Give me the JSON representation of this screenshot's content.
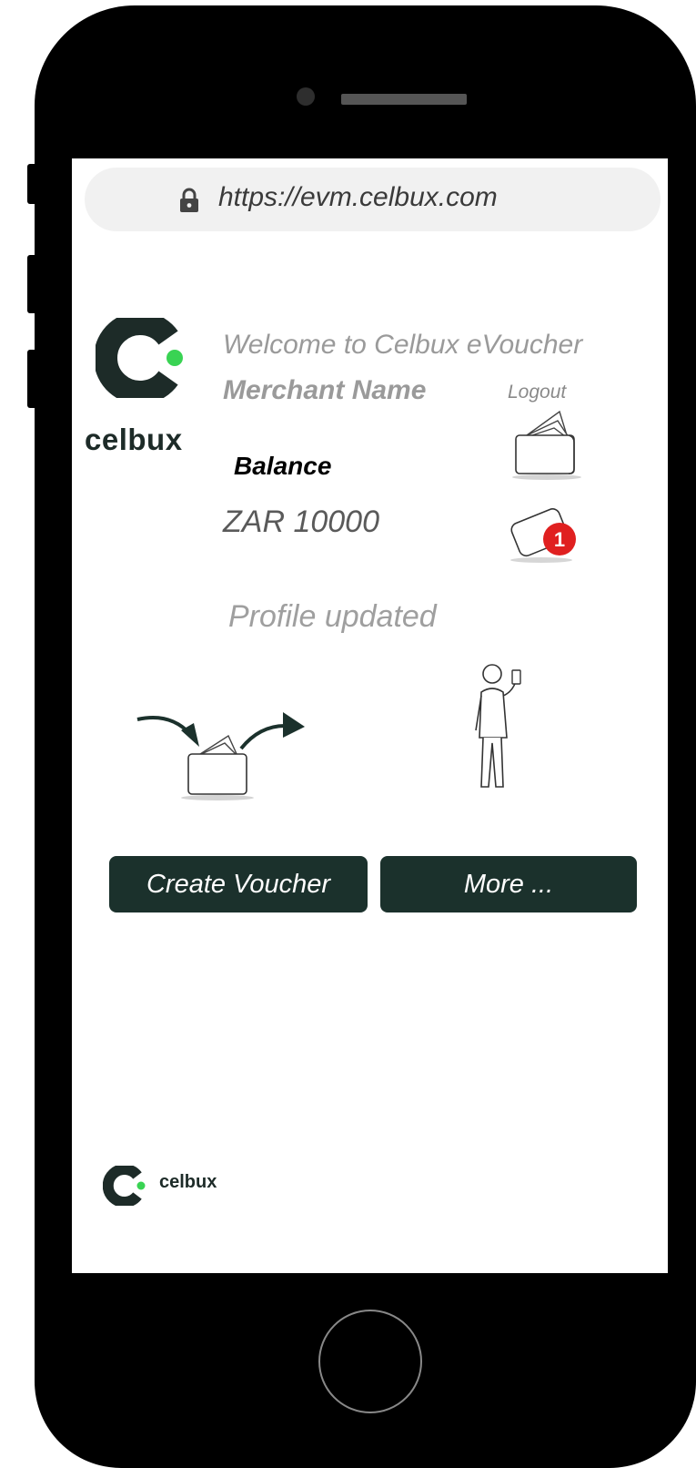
{
  "browser": {
    "url": "https://evm.celbux.com"
  },
  "header": {
    "logo_text": "celbux",
    "welcome": "Welcome to Celbux eVoucher",
    "merchant_name": "Merchant Name",
    "logout_label": "Logout"
  },
  "balance": {
    "label": "Balance",
    "value": "ZAR 10000"
  },
  "notifications": {
    "count": "1"
  },
  "status_message": "Profile updated",
  "actions": {
    "create_voucher_label": "Create Voucher",
    "more_label": "More ..."
  },
  "footer": {
    "logo_text": "celbux"
  },
  "colors": {
    "brand_dark": "#1b312c",
    "brand_green": "#39d353",
    "badge_red": "#e02020"
  },
  "icons": [
    "lock-icon",
    "celbux-logo-icon",
    "wallet-icon",
    "message-icon",
    "create-voucher-illustration",
    "person-phone-illustration"
  ]
}
